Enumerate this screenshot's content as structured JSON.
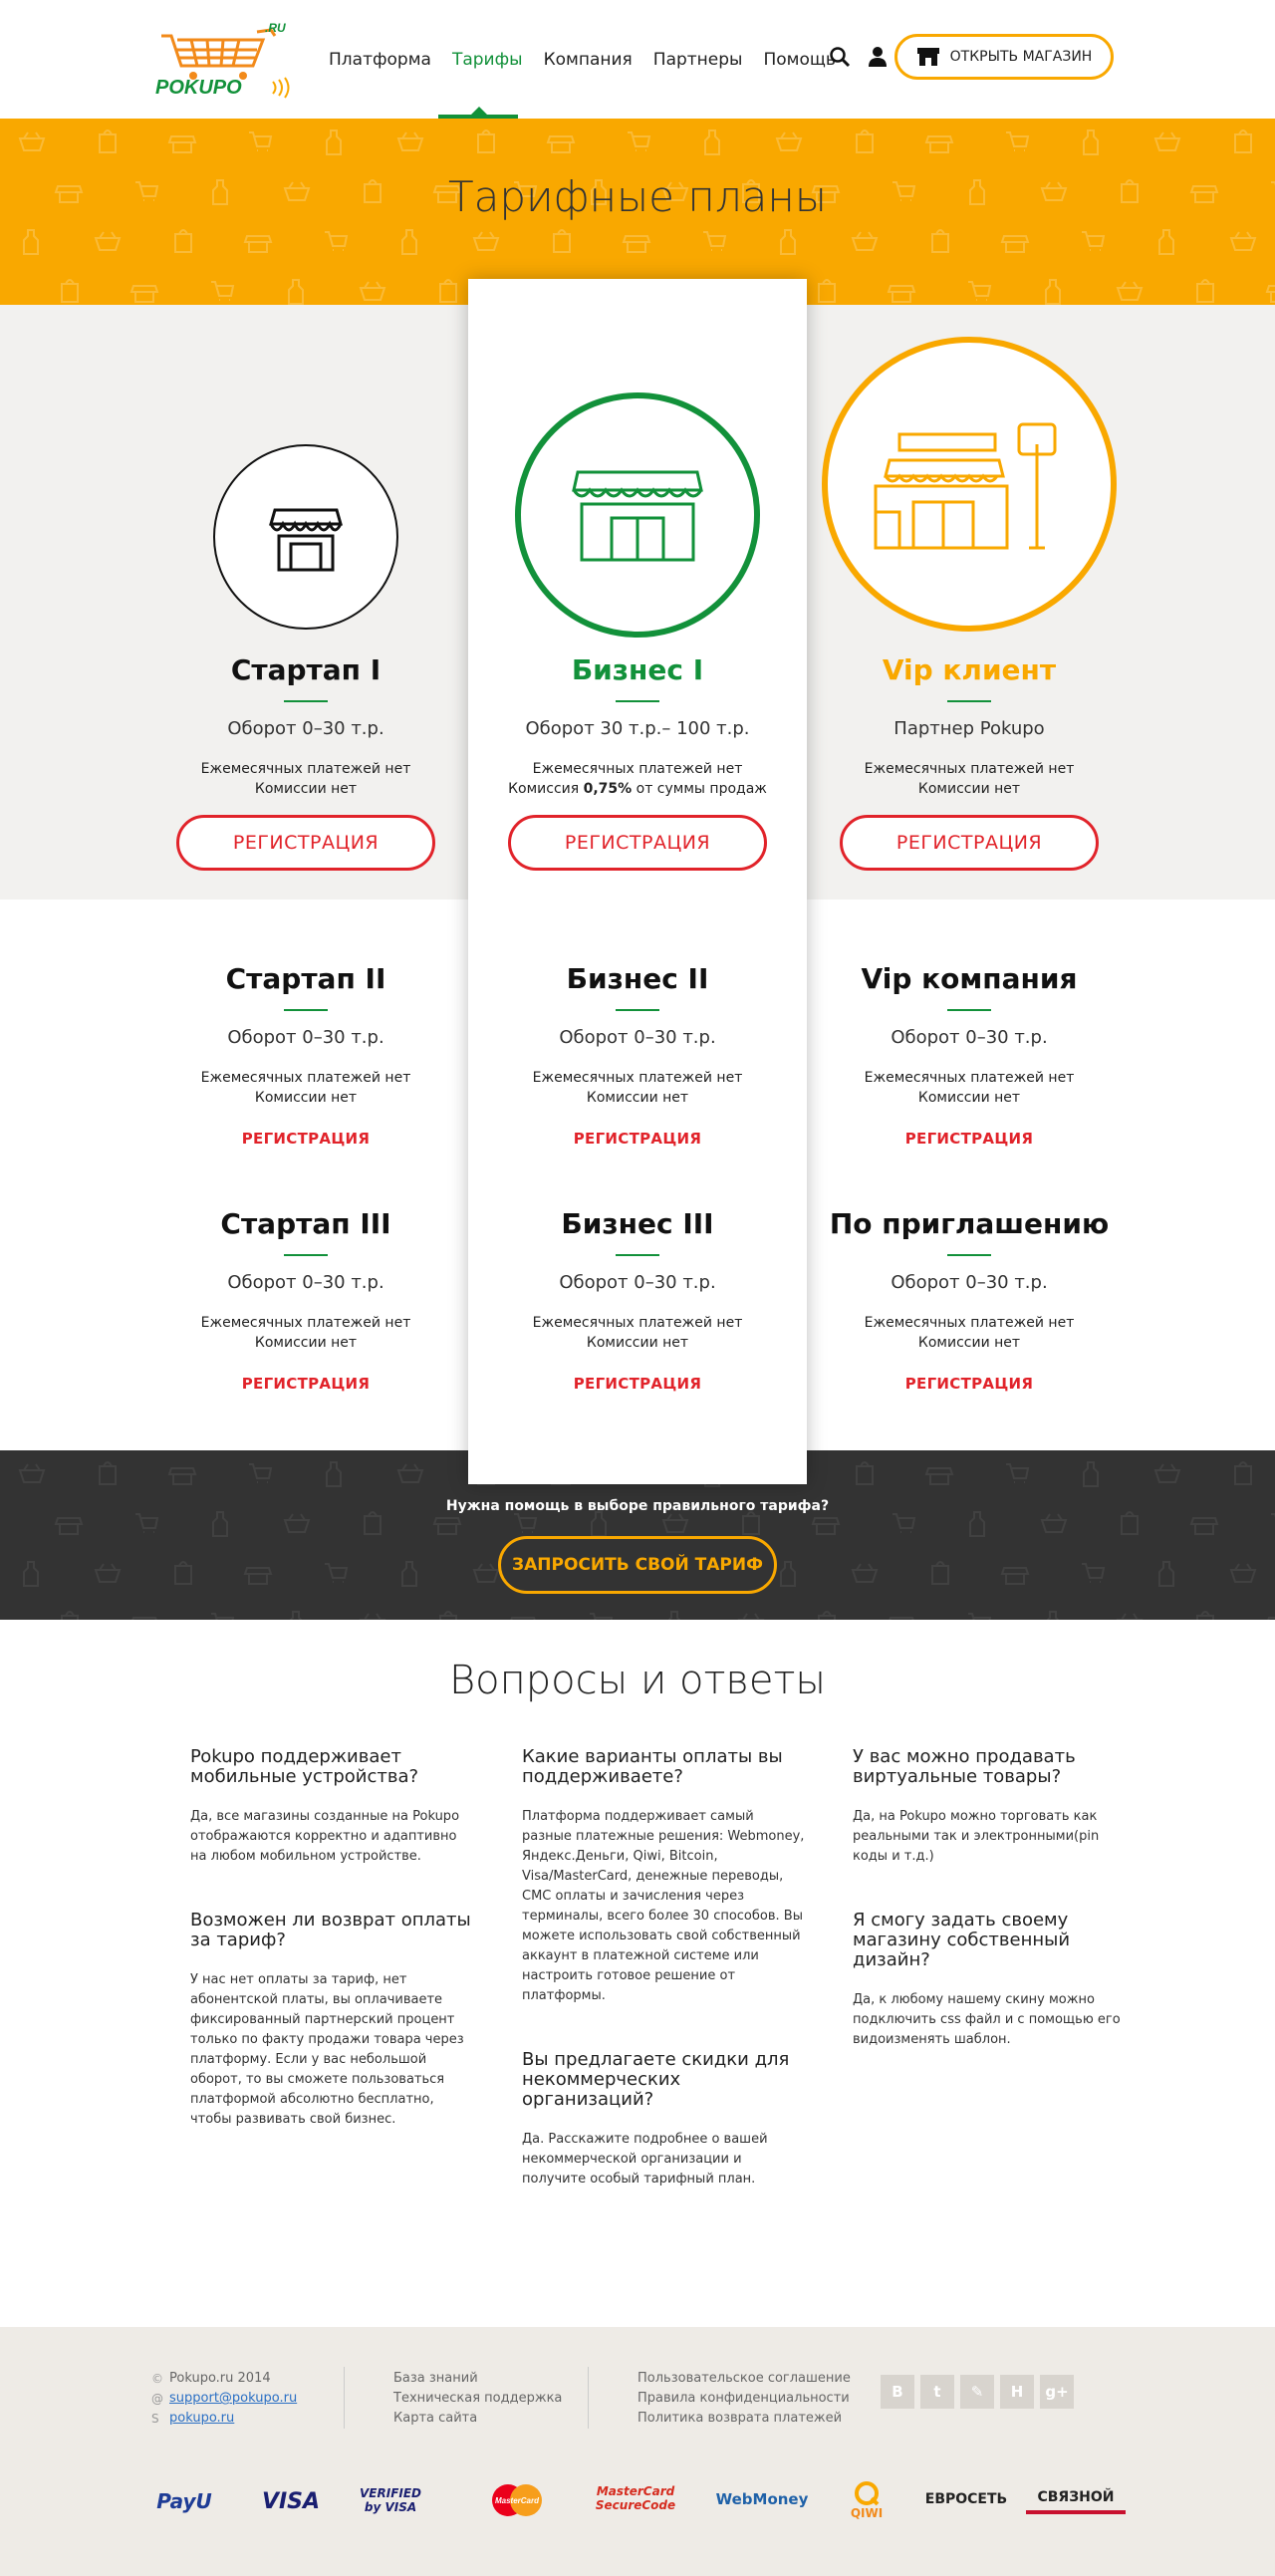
{
  "header": {
    "logo_text": "POKUPO",
    "logo_suffix": ".RU",
    "nav": [
      {
        "label": "Платформа",
        "active": false
      },
      {
        "label": "Тарифы",
        "active": true
      },
      {
        "label": "Компания",
        "active": false
      },
      {
        "label": "Партнеры",
        "active": false
      },
      {
        "label": "Помощь",
        "active": false
      }
    ],
    "open_shop_label": "ОТКРЫТЬ МАГАЗИН"
  },
  "hero": {
    "title": "Тарифные планы"
  },
  "plans_top": [
    {
      "name": "Стартап I",
      "turnover": "Оборот 0–30 т.р.",
      "desc1": "Ежемесячных платежей нет",
      "desc2": "Комиссии нет",
      "button": "РЕГИСТРАЦИЯ",
      "name_color": "#111111"
    },
    {
      "name": "Бизнес I",
      "turnover": "Оборот 30 т.р.– 100 т.р.",
      "desc1": "Ежемесячных платежей нет",
      "desc2_pre": "Комиссия ",
      "desc2_bold": "0,75%",
      "desc2_post": " от суммы продаж",
      "button": "РЕГИСТРАЦИЯ",
      "name_color": "#12913a"
    },
    {
      "name": "Vip клиент",
      "turnover": "Партнер Pokupo",
      "desc1": "Ежемесячных платежей нет",
      "desc2": "Комиссии нет",
      "button": "РЕГИСТРАЦИЯ",
      "name_color": "#f9a800"
    }
  ],
  "plans_mid": [
    {
      "name": "Стартап II",
      "turnover": "Оборот 0–30 т.р.",
      "desc1": "Ежемесячных платежей нет",
      "desc2": "Комиссии нет",
      "link": "РЕГИСТРАЦИЯ"
    },
    {
      "name": "Бизнес II",
      "turnover": "Оборот 0–30 т.р.",
      "desc1": "Ежемесячных платежей нет",
      "desc2": "Комиссии нет",
      "link": "РЕГИСТРАЦИЯ"
    },
    {
      "name": "Vip компания",
      "turnover": "Оборот 0–30 т.р.",
      "desc1": "Ежемесячных платежей нет",
      "desc2": "Комиссии нет",
      "link": "РЕГИСТРАЦИЯ"
    }
  ],
  "plans_bottom": [
    {
      "name": "Стартап III",
      "turnover": "Оборот 0–30 т.р.",
      "desc1": "Ежемесячных платежей нет",
      "desc2": "Комиссии нет",
      "link": "РЕГИСТРАЦИЯ"
    },
    {
      "name": "Бизнес III",
      "turnover": "Оборот 0–30 т.р.",
      "desc1": "Ежемесячных платежей нет",
      "desc2": "Комиссии нет",
      "link": "РЕГИСТРАЦИЯ"
    },
    {
      "name": "По приглашению",
      "turnover": "Оборот 0–30 т.р.",
      "desc1": "Ежемесячных платежей нет",
      "desc2": "Комиссии нет",
      "link": "РЕГИСТРАЦИЯ"
    }
  ],
  "help": {
    "text": "Нужна помощь в выборе правильного тарифа?",
    "button": "ЗАПРОСИТЬ СВОЙ ТАРИФ"
  },
  "faq": {
    "title": "Вопросы и ответы",
    "columns": [
      [
        {
          "q": "Pokupo поддерживает мобильные устройства?",
          "a": "Да, все магазины созданные на Pokupo отображаются корректно и адаптивно на любом мобильном устройстве."
        },
        {
          "q": "Возможен ли возврат оплаты за тариф?",
          "a": "У нас нет оплаты за тариф, нет абонентской платы, вы оплачиваете фиксированный партнерский процент только по факту продажи товара через платформу. Если у вас небольшой оборот, то вы сможете пользоваться платформой абсолютно бесплатно, чтобы развивать свой бизнес."
        }
      ],
      [
        {
          "q": "Какие варианты оплаты вы поддерживаете?",
          "a": "Платформа поддерживает самый разные платежные решения: Webmoney, Яндекс.Деньги, Qiwi, Bitcoin, Visa/MasterCard, денежные переводы, СМС оплаты и зачисления через терминалы, всего более 30 способов. Вы можете использовать свой собственный аккаунт в платежной системе или настроить готовое решение от платформы."
        },
        {
          "q": "Вы предлагаете скидки для некоммерческих организаций?",
          "a": "Да. Расскажите подробнее о вашей некоммерческой организации и получите особый тарифный план."
        }
      ],
      [
        {
          "q": "У вас можно продавать виртуальные товары?",
          "a": "Да, на Pokupo можно торговать как реальными так и электронными(pin коды и т.д.)"
        },
        {
          "q": "Я смогу задать своему магазину собственный дизайн?",
          "a": "Да, к любому нашему скину можно подключить css файл и с помощью его видоизменять шаблон."
        }
      ]
    ]
  },
  "footer": {
    "copyright": "Pokupo.ru 2014",
    "email": "support@pokupo.ru",
    "skype": "pokupo.ru",
    "links1": [
      "База знаний",
      "Техническая поддержка",
      "Карта сайта"
    ],
    "links2": [
      "Пользовательское соглашение",
      "Правила конфиденциальности",
      "Политика возврата платежей"
    ],
    "social": [
      "В",
      "t",
      "✎",
      "Н",
      "g+"
    ],
    "payments": [
      "PayU",
      "VISA",
      "VERIFIED by VISA",
      "MasterCard",
      "MasterCard SecureCode",
      "WebMoney",
      "QIWI",
      "ЕВРОСЕТЬ",
      "СВЯЗНОЙ"
    ]
  }
}
